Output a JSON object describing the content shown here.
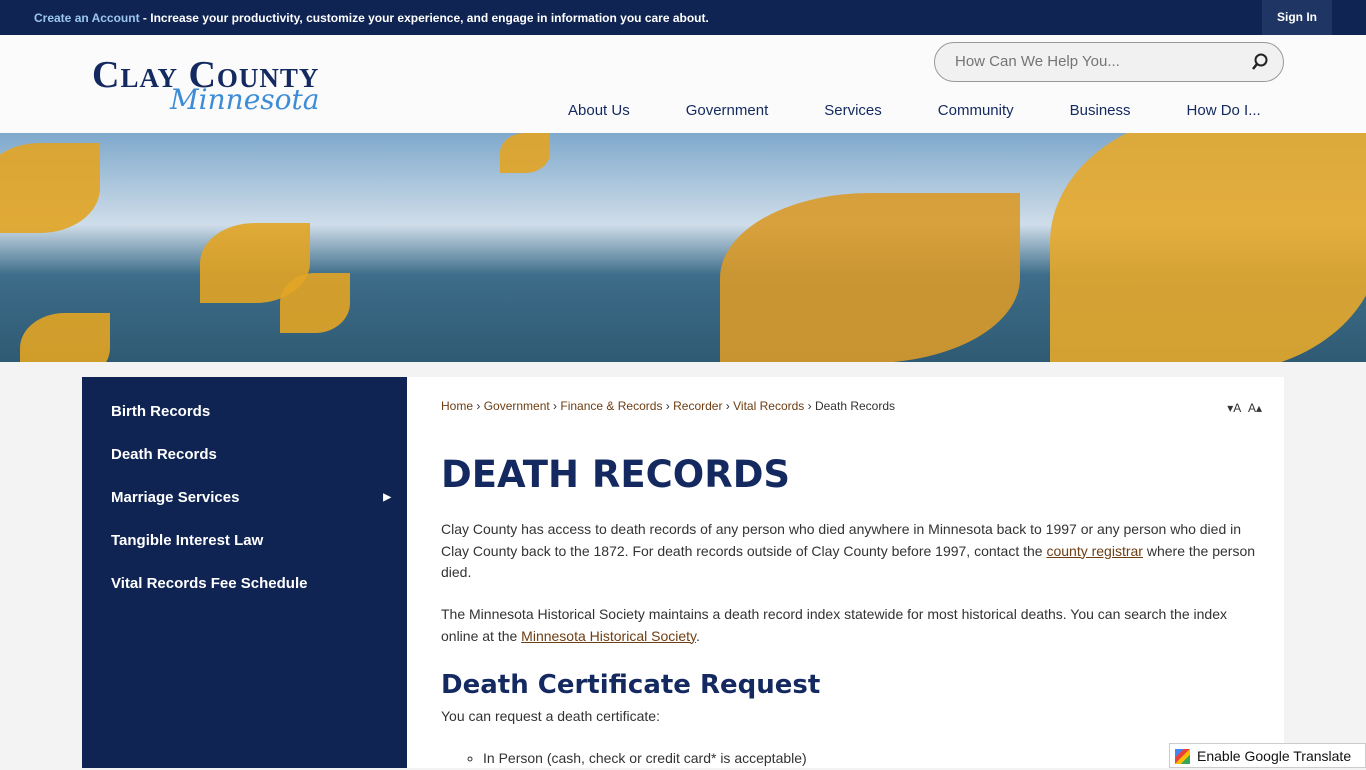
{
  "topbar": {
    "create_account": "Create an Account",
    "message": " - Increase your productivity, customize your experience, and engage in information you care about.",
    "sign_in": "Sign In"
  },
  "logo": {
    "line1": "Clay County",
    "line2": "Minnesota"
  },
  "search": {
    "placeholder": "How Can We Help You..."
  },
  "nav": [
    "About Us",
    "Government",
    "Services",
    "Community",
    "Business",
    "How Do I..."
  ],
  "sidebar": [
    {
      "label": "Birth Records"
    },
    {
      "label": "Death Records"
    },
    {
      "label": "Marriage Services",
      "has_submenu": true
    },
    {
      "label": "Tangible Interest Law"
    },
    {
      "label": "Vital Records Fee Schedule"
    }
  ],
  "breadcrumb": [
    "Home",
    "Government",
    "Finance & Records",
    "Recorder",
    "Vital Records"
  ],
  "breadcrumb_current": "Death Records",
  "font_size": {
    "decrease": "▾A",
    "increase": "A▴"
  },
  "page": {
    "title": "DEATH RECORDS",
    "p1a": "Clay County has access to death records of any person who died anywhere in Minnesota back to 1997 or any person who died in Clay County back to the 1872. For death records outside of Clay County before 1997, contact the ",
    "p1link": "county registrar",
    "p1b": " where the person died.",
    "p2a": "The Minnesota Historical Society maintains a death record index statewide for most historical deaths. You can search the index online at the ",
    "p2link": "Minnesota Historical Society",
    "p2b": ".",
    "h2": "Death Certificate Request",
    "p3": "You can request a death certificate:",
    "list": [
      "In Person (cash, check or credit card* is acceptable)"
    ]
  },
  "translate": "Enable Google Translate",
  "colors": {
    "navy": "#0f2453",
    "link": "#6e3d12",
    "accent": "#9cc6ee"
  }
}
